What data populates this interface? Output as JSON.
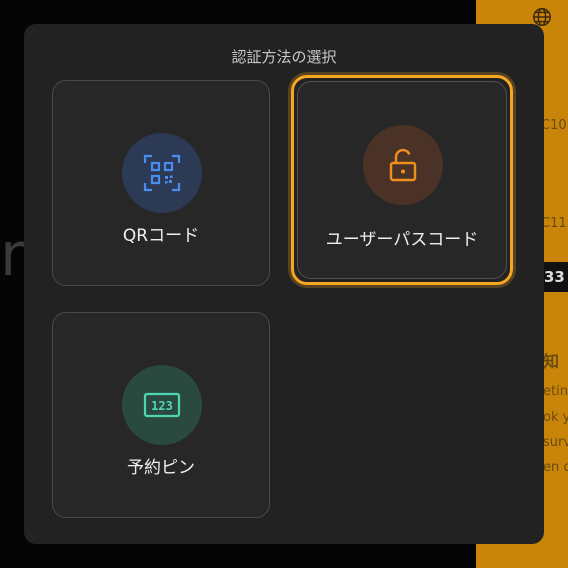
{
  "dialog": {
    "title": "認証方法の選択",
    "options": [
      {
        "label": "QRコード",
        "icon": "qr-code-icon",
        "color": "#4a8df0",
        "circle": "#2c3a55"
      },
      {
        "label": "ユーザーパスコード",
        "icon": "unlock-icon",
        "color": "#f0901c",
        "circle": "#4a3326",
        "selected": true
      },
      {
        "label": "予約ピン",
        "icon": "pin-123-icon",
        "color": "#4fd6b0",
        "circle": "#2a4a40"
      }
    ]
  },
  "background": {
    "accent": "#c8850a",
    "right_fragments": [
      "C10",
      "C11",
      "33",
      "知",
      "etin",
      "ok y",
      "surv",
      "en c"
    ],
    "globe_icon": "globe-icon"
  }
}
